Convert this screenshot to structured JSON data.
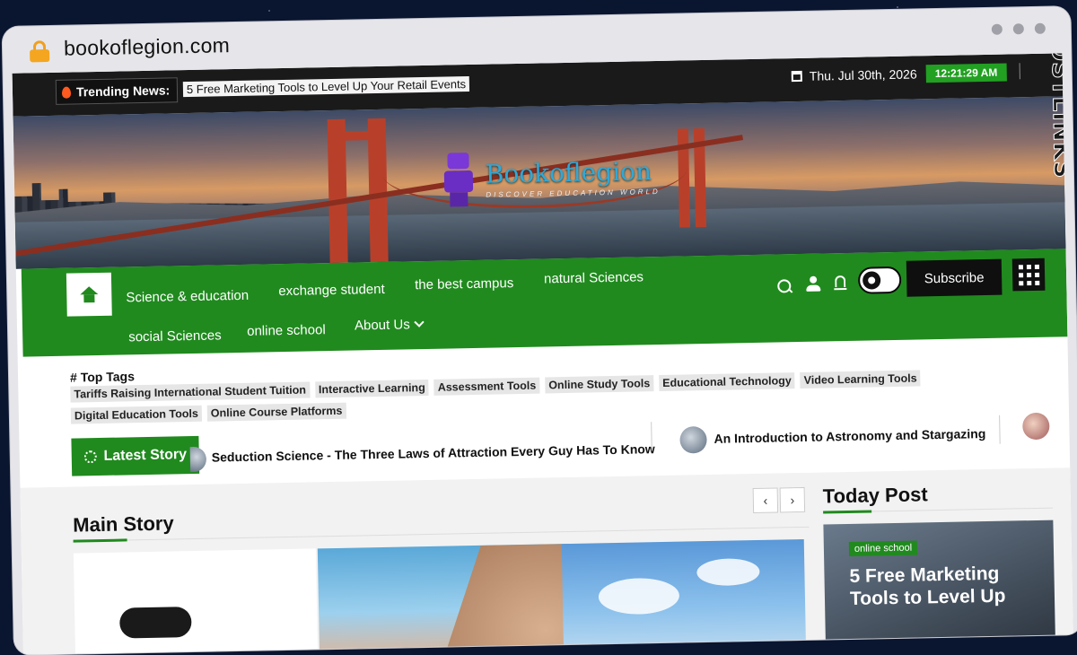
{
  "browser": {
    "url": "bookoflegion.com"
  },
  "topbar": {
    "trending_label": "Trending News:",
    "trending_text": "5 Free Marketing Tools to Level Up Your Retail Events",
    "date": "Thu. Jul 30th, 2026",
    "time": "12:21:29 AM"
  },
  "header": {
    "site_title": "Bookoflegion",
    "tagline": "DISCOVER EDUCATION WORLD"
  },
  "nav": {
    "items": [
      "Science & education",
      "exchange student",
      "the best campus",
      "natural Sciences",
      "social Sciences",
      "online school",
      "About Us"
    ],
    "subscribe_label": "Subscribe"
  },
  "tags": {
    "title": "# Top Tags",
    "items": [
      "Tariffs Raising International Student Tuition",
      "Interactive Learning",
      "Assessment Tools",
      "Online Study Tools",
      "Educational Technology",
      "Video Learning Tools",
      "Digital Education Tools",
      "Online Course Platforms"
    ]
  },
  "latest": {
    "label": "Latest Story",
    "items": [
      "Seduction Science - The Three Laws of Attraction Every Guy Has To Know",
      "An Introduction to Astronomy and Stargazing"
    ]
  },
  "main": {
    "title": "Main Story",
    "prev": "‹",
    "next": "›"
  },
  "today": {
    "title": "Today Post",
    "badge": "online school",
    "headline": "5 Free Marketing Tools to Level Up"
  },
  "watermark": {
    "text": "GUESTPOSTLINKS"
  },
  "colors": {
    "accent": "#208a1e",
    "dark": "#1a1a1a",
    "time_badge": "#22a022"
  }
}
